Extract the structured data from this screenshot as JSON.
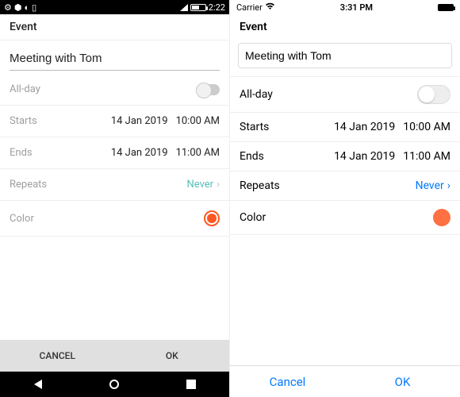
{
  "android": {
    "status": {
      "time": "2:22"
    },
    "header": "Event",
    "event_name": "Meeting with Tom",
    "rows": {
      "allday_label": "All-day",
      "starts_label": "Starts",
      "starts_date": "14 Jan 2019",
      "starts_time": "10:00 AM",
      "ends_label": "Ends",
      "ends_date": "14 Jan 2019",
      "ends_time": "11:00 AM",
      "repeats_label": "Repeats",
      "repeats_value": "Never",
      "color_label": "Color",
      "color_value": "#ff5722"
    },
    "footer": {
      "cancel": "CANCEL",
      "ok": "OK"
    }
  },
  "ios": {
    "status": {
      "carrier": "Carrier",
      "time": "3:31 PM"
    },
    "header": "Event",
    "event_name": "Meeting with Tom",
    "rows": {
      "allday_label": "All-day",
      "starts_label": "Starts",
      "starts_date": "14 Jan 2019",
      "starts_time": "10:00 AM",
      "ends_label": "Ends",
      "ends_date": "14 Jan 2019",
      "ends_time": "11:00 AM",
      "repeats_label": "Repeats",
      "repeats_value": "Never",
      "color_label": "Color",
      "color_value": "#ff7043"
    },
    "footer": {
      "cancel": "Cancel",
      "ok": "OK"
    }
  }
}
